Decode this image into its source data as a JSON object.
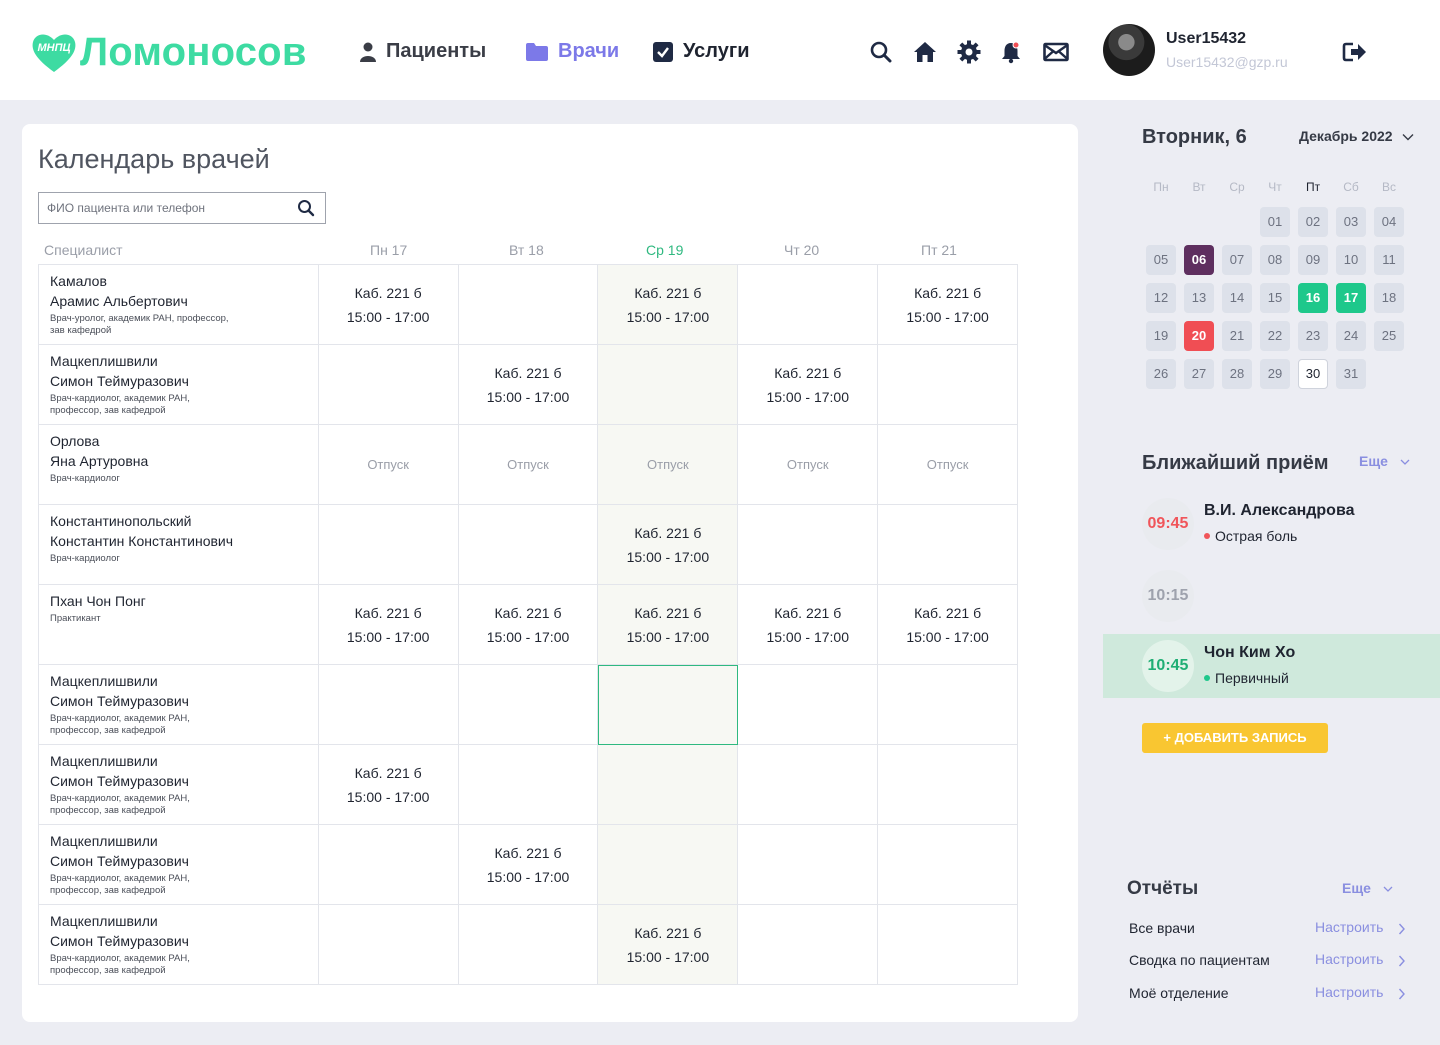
{
  "app": {
    "logo_mark": "МНПЦ",
    "logo_name": "Ломоносов"
  },
  "nav": {
    "patients": "Пациенты",
    "doctors": "Врачи",
    "services": "Услуги"
  },
  "header_icons": [
    "search-icon",
    "home-icon",
    "gear-icon",
    "bell-icon",
    "mail-icon"
  ],
  "user": {
    "name": "User15432",
    "email": "User15432@gzp.ru"
  },
  "page": {
    "title": "Календарь врачей",
    "search_placeholder": "ФИО пациента или телефон"
  },
  "grid": {
    "specialist_header": "Специалист",
    "days": [
      "Пн 17",
      "Вт 18",
      "Ср 19",
      "Чт 20",
      "Пт 21"
    ],
    "today_index": 2,
    "rows": [
      {
        "name": "Камалов\nАрамис Альбертович",
        "role": "Врач-уролог, академик РАН, профессор,\nзав кафедрой",
        "cells": [
          [
            "Каб. 221 б",
            "15:00 - 17:00"
          ],
          null,
          [
            "Каб. 221 б",
            "15:00 - 17:00"
          ],
          null,
          [
            "Каб. 221 б",
            "15:00 - 17:00"
          ]
        ]
      },
      {
        "name": "Мацкеплишвили\nСимон Теймуразович",
        "role": "Врач-кардиолог, академик РАН,\nпрофессор, зав кафедрой",
        "cells": [
          null,
          [
            "Каб. 221 б",
            "15:00 - 17:00"
          ],
          null,
          [
            "Каб. 221 б",
            "15:00 - 17:00"
          ],
          null
        ]
      },
      {
        "name": "Орлова\nЯна Артуровна",
        "role": "Врач-кардиолог",
        "cells": [
          "Отпуск",
          "Отпуск",
          "Отпуск",
          "Отпуск",
          "Отпуск"
        ]
      },
      {
        "name": "Константинопольский\nКонстантин Константинович",
        "role": "Врач-кардиолог",
        "cells": [
          null,
          null,
          [
            "Каб. 221 б",
            "15:00 - 17:00"
          ],
          null,
          null
        ]
      },
      {
        "name": "Пхан Чон Понг",
        "role": "Практикант",
        "cells": [
          [
            "Каб. 221 б",
            "15:00 - 17:00"
          ],
          [
            "Каб. 221 б",
            "15:00 - 17:00"
          ],
          [
            "Каб. 221 б",
            "15:00 - 17:00"
          ],
          [
            "Каб. 221 б",
            "15:00 - 17:00"
          ],
          [
            "Каб. 221 б",
            "15:00 - 17:00"
          ]
        ]
      },
      {
        "name": "Мацкеплишвили\nСимон Теймуразович",
        "role": "Врач-кардиолог, академик РАН,\nпрофессор, зав кафедрой",
        "cells": [
          null,
          null,
          "selected",
          null,
          null
        ]
      },
      {
        "name": "Мацкеплишвили\nСимон Теймуразович",
        "role": "Врач-кардиолог, академик РАН,\nпрофессор, зав кафедрой",
        "cells": [
          [
            "Каб. 221 б",
            "15:00 - 17:00"
          ],
          null,
          null,
          null,
          null
        ]
      },
      {
        "name": "Мацкеплишвили\nСимон Теймуразович",
        "role": "Врач-кардиолог, академик РАН,\nпрофессор, зав кафедрой",
        "cells": [
          null,
          [
            "Каб. 221 б",
            "15:00 - 17:00"
          ],
          null,
          null,
          null
        ]
      },
      {
        "name": "Мацкеплишвили\nСимон Теймуразович",
        "role": "Врач-кардиолог, академик РАН,\nпрофессор, зав кафедрой",
        "cells": [
          null,
          null,
          [
            "Каб. 221 б",
            "15:00 - 17:00"
          ],
          null,
          null
        ]
      }
    ]
  },
  "calendar": {
    "date_label": "Вторник, 6",
    "month_label": "Декабрь 2022",
    "weekdays": [
      "Пн",
      "Вт",
      "Ср",
      "Чт",
      "Пт",
      "Сб",
      "Вс"
    ],
    "first_weekday_index": 3,
    "days": [
      "01",
      "02",
      "03",
      "04",
      "05",
      "06",
      "07",
      "08",
      "09",
      "10",
      "11",
      "12",
      "13",
      "14",
      "15",
      "16",
      "17",
      "18",
      "19",
      "20",
      "21",
      "22",
      "23",
      "24",
      "25",
      "26",
      "27",
      "28",
      "29",
      "30",
      "31"
    ],
    "highlights": {
      "06": "purple",
      "16": "green",
      "17": "green",
      "20": "red",
      "30": "outlined"
    },
    "colors": {
      "purple": "#5e2f5f",
      "green": "#1ec88b",
      "red": "#f04e54"
    }
  },
  "nearest": {
    "title": "Ближайший приём",
    "more": "Еще",
    "items": [
      {
        "time": "09:45",
        "name": "В.И. Александрова",
        "note": "Острая боль",
        "time_color": "#f0555a",
        "dot_color": "#f0555a",
        "active": false
      },
      {
        "time": "10:15",
        "name": "",
        "note": "",
        "time_color": "#9ea2ad",
        "dot_color": "",
        "active": false
      },
      {
        "time": "10:45",
        "name": "Чон Ким Хо",
        "note": "Первичный",
        "time_color": "#1fae74",
        "dot_color": "#1ec88b",
        "active": true
      }
    ],
    "add_button": "+ ДОБАВИТЬ ЗАПИСЬ"
  },
  "reports": {
    "title": "Отчёты",
    "more": "Еще",
    "items": [
      {
        "label": "Все врачи",
        "action": "Настроить"
      },
      {
        "label": "Сводка по пациентам",
        "action": "Настроить"
      },
      {
        "label": "Моё отделение",
        "action": "Настроить"
      }
    ]
  },
  "colors": {
    "brand": "#3ddba2",
    "accent": "#7c79e8",
    "button": "#f9c631"
  }
}
